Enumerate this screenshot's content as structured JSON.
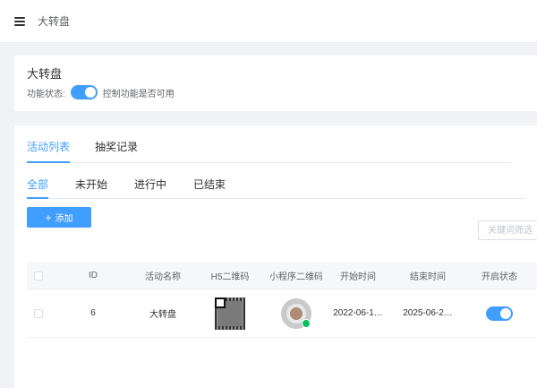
{
  "header": {
    "breadcrumb": "大转盘"
  },
  "module": {
    "title": "大转盘",
    "status_label": "功能状态:",
    "status_hint": "控制功能是否可用",
    "status_enabled": true
  },
  "tabs": [
    {
      "label": "活动列表",
      "active": true
    },
    {
      "label": "抽奖记录",
      "active": false
    }
  ],
  "subtabs": [
    {
      "label": "全部",
      "active": true
    },
    {
      "label": "未开始",
      "active": false
    },
    {
      "label": "进行中",
      "active": false
    },
    {
      "label": "已结束",
      "active": false
    }
  ],
  "toolbar": {
    "add_label": "添加",
    "search_placeholder": "关键词筛选"
  },
  "table": {
    "columns": [
      "ID",
      "活动名称",
      "H5二维码",
      "小程序二维码",
      "开始时间",
      "结束时间",
      "开启状态"
    ],
    "rows": [
      {
        "id": "6",
        "name": "大转盘",
        "start": "2022-06-1…",
        "end": "2025-06-2…",
        "enabled": true
      }
    ]
  },
  "colors": {
    "accent": "#409eff",
    "wechat_green": "#07c160"
  }
}
